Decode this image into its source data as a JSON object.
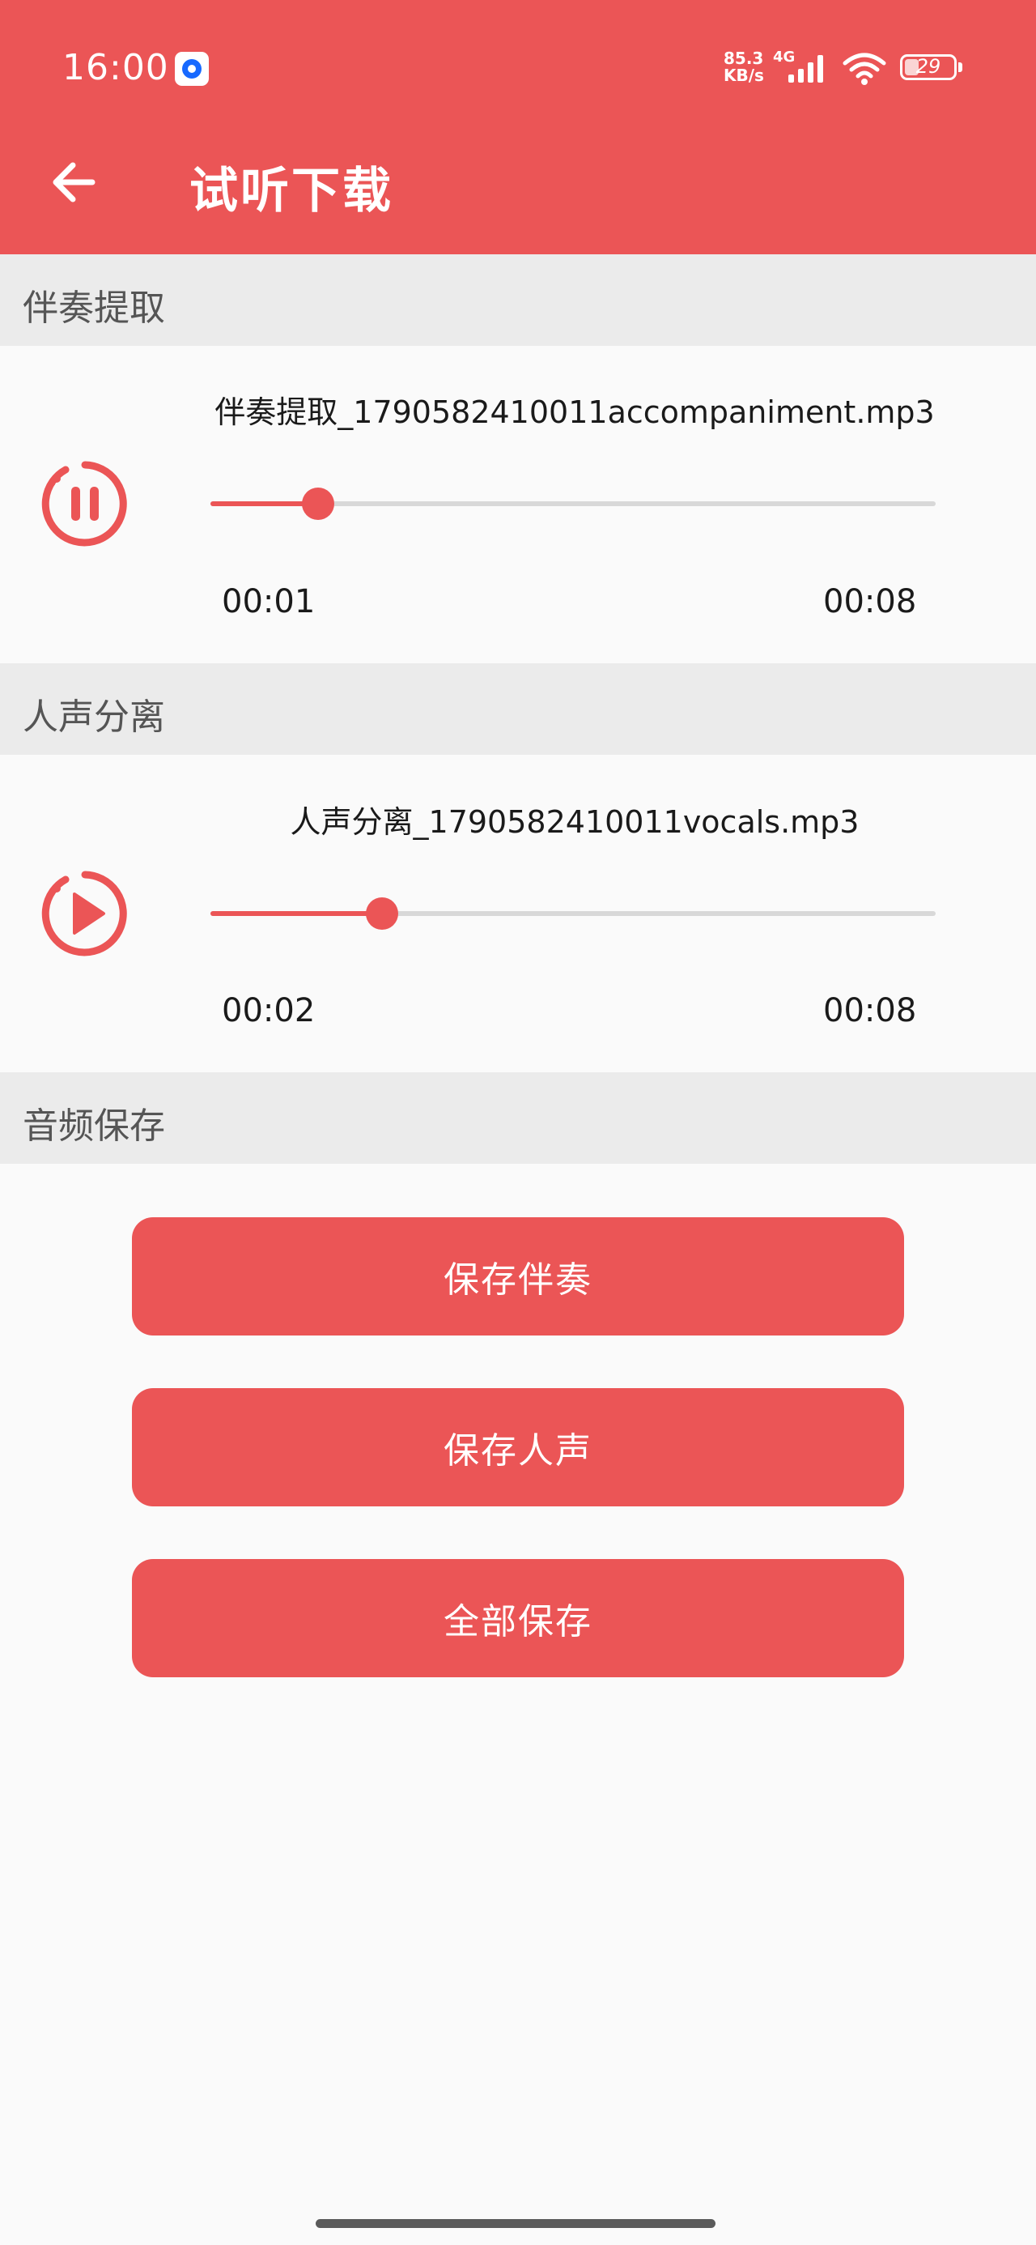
{
  "status_bar": {
    "time": "16:00",
    "net_speed_value": "85.3",
    "net_speed_unit": "KB/s",
    "network_type": "4G",
    "battery_level": "29",
    "icons": [
      "notification-app-icon",
      "signal-icon",
      "wifi-icon",
      "battery-icon"
    ]
  },
  "header": {
    "back_icon": "arrow-left-icon",
    "title": "试听下载"
  },
  "sections": {
    "accompaniment": {
      "header": "伴奏提取",
      "file_name": "伴奏提取_1790582410011accompaniment.mp3",
      "state_icon": "pause-icon",
      "current_time": "00:01",
      "total_time": "00:08",
      "progress": 0.148
    },
    "vocals": {
      "header": "人声分离",
      "file_name": "人声分离_1790582410011vocals.mp3",
      "state_icon": "play-icon",
      "current_time": "00:02",
      "total_time": "00:08",
      "progress": 0.237
    },
    "save": {
      "header": "音频保存",
      "buttons": {
        "save_accompaniment": "保存伴奏",
        "save_vocals": "保存人声",
        "save_all": "全部保存"
      }
    }
  },
  "colors": {
    "accent": "#eb5556",
    "section_bg": "#ebebeb",
    "page_bg": "#fafafa",
    "track": "#d8d8d8"
  }
}
